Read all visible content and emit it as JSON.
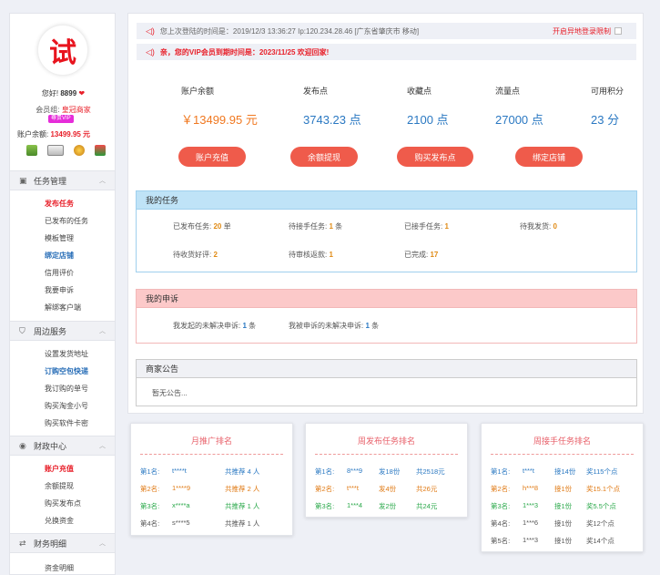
{
  "user": {
    "avatar_char": "试",
    "greeting": "您好!",
    "user_id": "8899",
    "member_label": "会员组:",
    "member_group": "皇冠商家",
    "vip_badge": "尊贵VIP",
    "balance_label": "账户余额:",
    "balance_value": "13499.95 元"
  },
  "sidebar": {
    "sections": [
      {
        "title": "任务管理",
        "icon": "calendar-icon",
        "items": [
          "发布任务",
          "已发布的任务",
          "模板管理",
          "绑定店铺",
          "信用评价",
          "我要申诉",
          "解绑客户端"
        ]
      },
      {
        "title": "周边服务",
        "icon": "shirt-icon",
        "items": [
          "设置发货地址",
          "订购空包快递",
          "我订购的单号",
          "购买淘金小号",
          "购买软件卡密"
        ]
      },
      {
        "title": "财政中心",
        "icon": "coin-icon",
        "items": [
          "账户充值",
          "余额提现",
          "购买发布点",
          "兑换资金"
        ]
      },
      {
        "title": "财务明细",
        "icon": "transfer-icon",
        "items": [
          "资金明细"
        ]
      }
    ]
  },
  "notices": {
    "login_info": "您上次登陆的时间是：2019/12/3 13:36:27  Ip:120.234.28.46 [广东省肇庆市 移动]",
    "remote_login_toggle": "开启异地登录限制",
    "vip_alert": "亲，您的VIP会员到期时间是：2023/11/25  欢迎回家!"
  },
  "stats": [
    {
      "label": "账户余额",
      "value": "￥13499.95 元"
    },
    {
      "label": "发布点",
      "value": "3743.23 点"
    },
    {
      "label": "收藏点",
      "value": "2100 点"
    },
    {
      "label": "流量点",
      "value": "27000 点"
    },
    {
      "label": "可用积分",
      "value": "23 分"
    }
  ],
  "buttons": [
    "账户充值",
    "余额提现",
    "购买发布点",
    "绑定店铺"
  ],
  "my_tasks": {
    "title": "我的任务",
    "cells": [
      {
        "label": "已发布任务:",
        "value": "20",
        "unit": "单"
      },
      {
        "label": "待接手任务:",
        "value": "1",
        "unit": "条"
      },
      {
        "label": "已接手任务:",
        "value": "1",
        "unit": ""
      },
      {
        "label": "待我发货:",
        "value": "0",
        "unit": ""
      },
      {
        "label": "待收货好评:",
        "value": "2",
        "unit": ""
      },
      {
        "label": "待审核返款:",
        "value": "1",
        "unit": ""
      },
      {
        "label": "已完成:",
        "value": "17",
        "unit": ""
      }
    ]
  },
  "my_appeals": {
    "title": "我的申诉",
    "cells": [
      {
        "label": "我发起的未解决申诉:",
        "value": "1",
        "unit": "条"
      },
      {
        "label": "我被申诉的未解决申诉:",
        "value": "1",
        "unit": "条"
      }
    ]
  },
  "announcement": {
    "title": "商家公告",
    "body": "暂无公告..."
  },
  "rankings": [
    {
      "title": "月推广排名",
      "rows": [
        [
          "第1名:",
          "t****t",
          "",
          "共推荐 4 人"
        ],
        [
          "第2名:",
          "1****9",
          "",
          "共推荐 2 人"
        ],
        [
          "第3名:",
          "x****a",
          "",
          "共推荐 1 人"
        ],
        [
          "第4名:",
          "s****5",
          "",
          "共推荐 1 人"
        ]
      ]
    },
    {
      "title": "周发布任务排名",
      "rows": [
        [
          "第1名:",
          "8***9",
          "发18份",
          "共2518元"
        ],
        [
          "第2名:",
          "t***t",
          "发4份",
          "共26元"
        ],
        [
          "第3名:",
          "1***4",
          "发2份",
          "共24元"
        ]
      ]
    },
    {
      "title": "周接手任务排名",
      "rows": [
        [
          "第1名:",
          "t***t",
          "接14份",
          "奖115个点"
        ],
        [
          "第2名:",
          "h***8",
          "接1份",
          "奖15.1个点"
        ],
        [
          "第3名:",
          "1***3",
          "接1份",
          "奖5.5个点"
        ],
        [
          "第4名:",
          "1***6",
          "接1份",
          "奖12个点"
        ],
        [
          "第5名:",
          "1***3",
          "接1份",
          "奖14个点"
        ]
      ]
    }
  ]
}
